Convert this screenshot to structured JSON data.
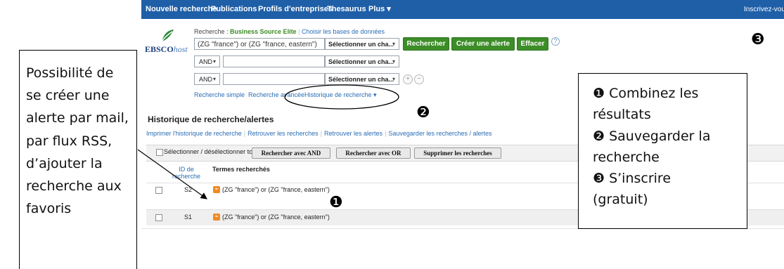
{
  "nav": {
    "items": [
      "Nouvelle recherche",
      "Publications",
      "Profils d'entreprises",
      "Thesaurus",
      "Plus ▾"
    ],
    "signin": "Inscrivez-vous"
  },
  "logo": {
    "part1": "EBSCO",
    "part2": "host"
  },
  "search": {
    "source_prefix": "Recherche : ",
    "database": "Business Source Elite",
    "choose_db": "Choisir les bases de données",
    "query": "(ZG \"france\") or (ZG \"france, eastern\")",
    "field_select": "Sélectionner un cha...",
    "bool1": "AND",
    "bool2": "AND",
    "field_select2": "Sélectionner un cha...",
    "field_select3": "Sélectionner un cha...",
    "btn_search": "Rechercher",
    "btn_alert": "Créer une alerte",
    "btn_clear": "Effacer",
    "help": "?",
    "plus": "+",
    "minus": "−",
    "link_simple": "Recherche simple",
    "link_advanced": "Recherche avancée",
    "link_history": "Historique de recherche ▾"
  },
  "history": {
    "title": "Historique de recherche/alertes",
    "links": [
      "Imprimer l'historique de recherche",
      "Retrouver les recherches",
      "Retrouver les alertes",
      "Sauvegarder les recherches / alertes"
    ],
    "select_all": "Sélectionner / désélectionner tout",
    "btn_and": "Rechercher avec AND",
    "btn_or": "Rechercher avec OR",
    "btn_delete": "Supprimer les recherches",
    "col_id": "ID de recherche",
    "col_terms": "Termes recherchés",
    "rows": [
      {
        "id": "S2",
        "terms": "(ZG \"france\") or (ZG \"france, eastern\")"
      },
      {
        "id": "S1",
        "terms": "(ZG \"france\") or (ZG \"france, eastern\")"
      }
    ],
    "rss_glyph": "⌁"
  },
  "annotations": {
    "left_text": "Possibilité de se créer une alerte par mail, par flux RSS, d’ajouter la recherche aux favoris",
    "right_lines": [
      "❶ Combinez les",
      "résultats",
      "❷ Sauvegarder la",
      "recherche",
      "❸ S’inscrire",
      "(gratuit)"
    ],
    "marker1": "❶",
    "marker2": "❷",
    "marker3": "❸"
  }
}
